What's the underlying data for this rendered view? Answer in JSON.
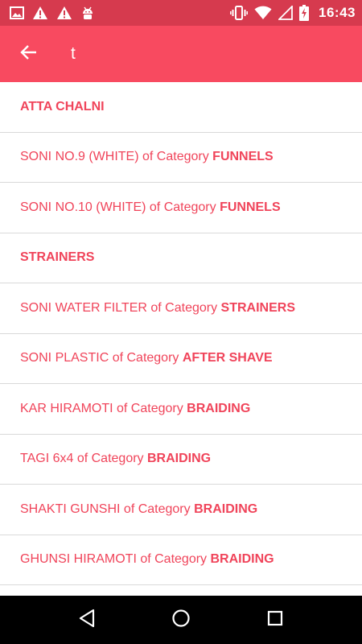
{
  "status_bar": {
    "time": "16:43",
    "left_icons": [
      "image-icon",
      "warning-icon",
      "warning-icon",
      "android-icon"
    ],
    "right_icons": [
      "vibrate-icon",
      "wifi-icon",
      "signal-icon",
      "battery-charging-icon"
    ]
  },
  "toolbar": {
    "back_icon": "arrow-back-icon",
    "search_value": "t"
  },
  "results": [
    {
      "name": "ATTA CHALNI",
      "connector": "",
      "category": ""
    },
    {
      "name": "SONI NO.9 (WHITE)",
      "connector": " of Category ",
      "category": "FUNNELS"
    },
    {
      "name": "SONI NO.10 (WHITE)",
      "connector": " of Category ",
      "category": "FUNNELS"
    },
    {
      "name": "STRAINERS",
      "connector": "",
      "category": ""
    },
    {
      "name": "SONI WATER FILTER",
      "connector": " of Category ",
      "category": "STRAINERS"
    },
    {
      "name": "SONI PLASTIC",
      "connector": " of Category ",
      "category": "AFTER SHAVE"
    },
    {
      "name": "KAR HIRAMOTI",
      "connector": " of Category ",
      "category": "BRAIDING"
    },
    {
      "name": "TAGI 6x4",
      "connector": " of Category ",
      "category": "BRAIDING"
    },
    {
      "name": "SHAKTI GUNSHI",
      "connector": " of Category ",
      "category": "BRAIDING"
    },
    {
      "name": "GHUNSI HIRAMOTI",
      "connector": " of Category ",
      "category": "BRAIDING"
    }
  ],
  "nav_bar": {
    "back": "nav-back-icon",
    "home": "nav-home-icon",
    "recents": "nav-recents-icon"
  },
  "colors": {
    "accent": "#f84a60",
    "status_bar": "#d63a4e",
    "item_text": "#f0445a",
    "divider": "#d9d9d9",
    "nav_bar": "#000000"
  }
}
